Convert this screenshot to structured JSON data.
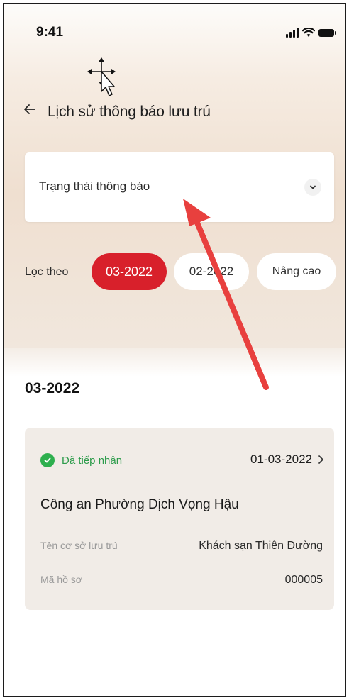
{
  "status_bar": {
    "time": "9:41"
  },
  "header": {
    "back_icon": "arrow-left-icon",
    "title": "Lịch sử thông báo lưu trú"
  },
  "status_filter": {
    "placeholder": "Trạng thái thông báo",
    "icon": "chevron-down-icon"
  },
  "filter": {
    "label": "Lọc theo",
    "chips": [
      {
        "label": "03-2022",
        "active": true
      },
      {
        "label": "02-2022",
        "active": false
      },
      {
        "label": "Nâng cao",
        "active": false
      }
    ]
  },
  "section": {
    "title": "03-2022",
    "cards": [
      {
        "status": "Đã tiếp nhận",
        "date": "01-03-2022",
        "title": "Công an Phường Dịch Vọng Hậu",
        "rows": [
          {
            "label": "Tên cơ sở lưu trú",
            "value": "Khách sạn Thiên Đường"
          },
          {
            "label": "Mã hồ sơ",
            "value": "000005"
          }
        ]
      }
    ]
  },
  "colors": {
    "accent": "#d8202b",
    "success": "#2eaf4e",
    "annotation_arrow": "#e8403e",
    "card_bg": "#f1ece7"
  }
}
